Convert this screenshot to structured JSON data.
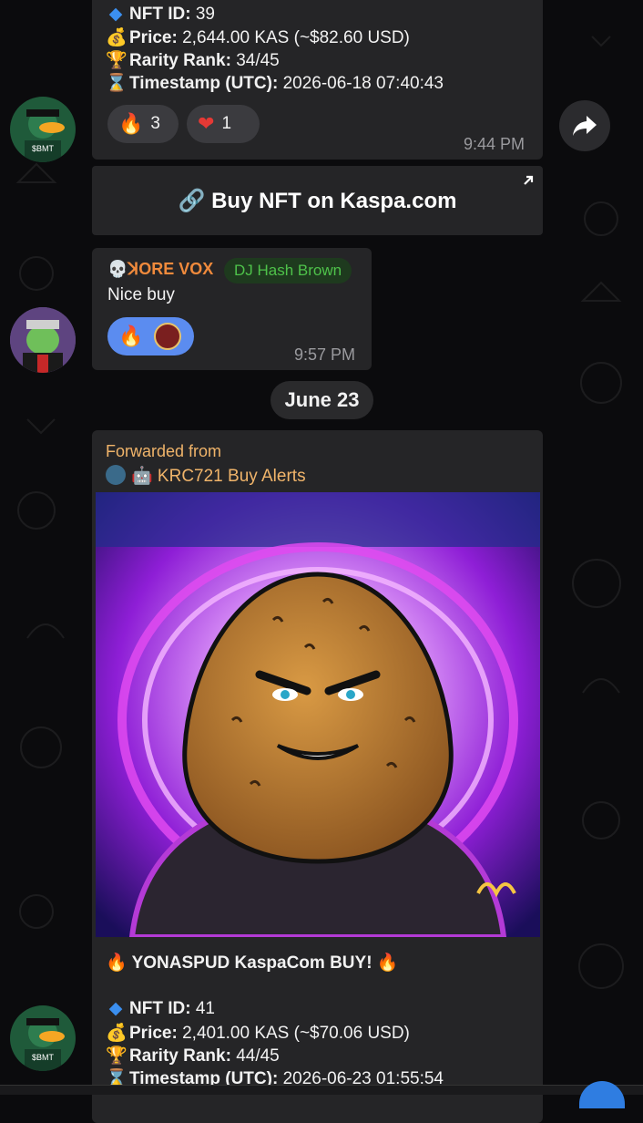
{
  "msg1": {
    "nft_id_label": "NFT ID:",
    "nft_id": "39",
    "price_label": "Price:",
    "price": "2,644.00 KAS (~$82.60 USD)",
    "rank_label": "Rarity Rank:",
    "rank": "34/45",
    "ts_label": "Timestamp (UTC):",
    "ts": "2026-06-18 07:40:43",
    "reactions": [
      {
        "icon": "fire-icon",
        "count": "3"
      },
      {
        "icon": "heart-icon",
        "count": "1"
      }
    ],
    "time": "9:44 PM",
    "avatar_text": "$BMT"
  },
  "buy_button": {
    "label": "🔗 Buy NFT on Kaspa.com"
  },
  "msg2": {
    "sender": "💀ꓘORE VOX",
    "tag": "DJ Hash Brown",
    "text": "Nice buy",
    "time": "9:57 PM"
  },
  "date_divider": "June 23",
  "msg3": {
    "forwarded_label": "Forwarded from",
    "forwarded_source": "🤖 KRC721 Buy Alerts",
    "headline": "🔥 YONASPUD KaspaCom BUY! 🔥",
    "nft_id_label": "NFT ID:",
    "nft_id": "41",
    "price_label": "Price:",
    "price": "2,401.00 KAS (~$70.06 USD)",
    "rank_label": "Rarity Rank:",
    "rank": "44/45",
    "ts_label": "Timestamp (UTC):",
    "ts": "2026-06-23 01:55:54",
    "avatar_text": "$BMT"
  }
}
